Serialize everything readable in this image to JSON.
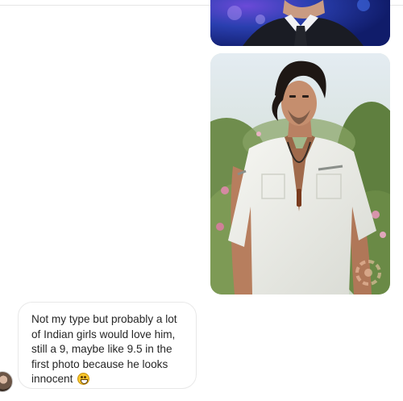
{
  "thread": {
    "sent_images": [
      {
        "kind": "photo",
        "subject": "man in dark suit and tie"
      },
      {
        "kind": "photo",
        "subject": "man with dark hair in white shirt outdoors"
      }
    ],
    "received_message": {
      "lines": [
        "Not my type but probably a lot",
        "of Indian girls would love him,",
        "still a 9, maybe like 9.5 in the",
        "first photo because he looks",
        "innocent"
      ],
      "emoji": "grinning-face-emoji"
    }
  },
  "colors": {
    "bubble_border": "#e8e8e8",
    "text": "#262626",
    "photo1_bg": "#1d2f8a"
  }
}
